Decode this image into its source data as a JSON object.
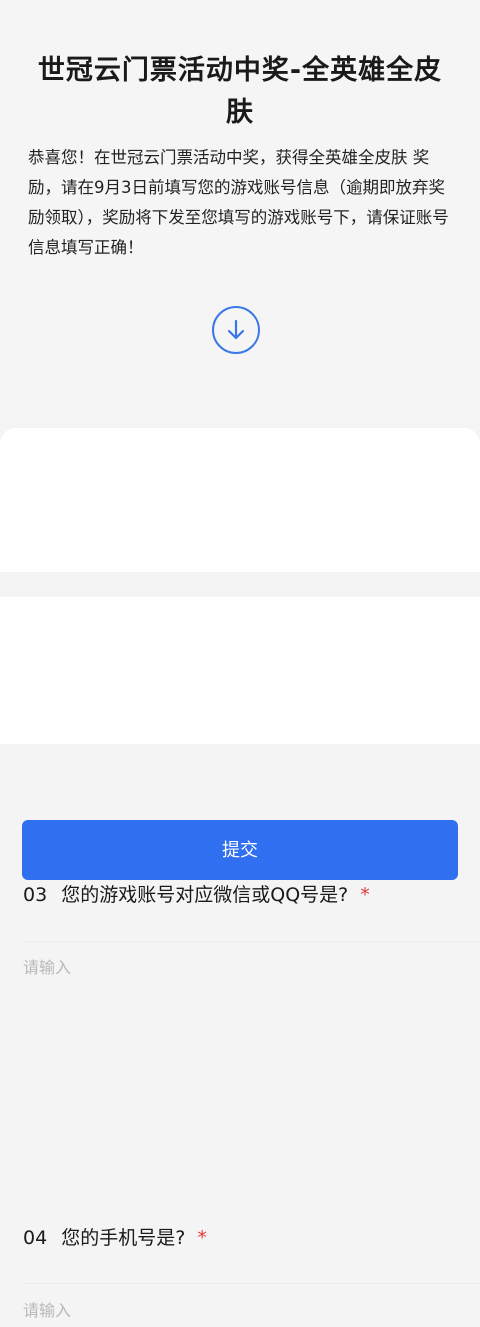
{
  "form": {
    "title": "世冠云门票活动中奖-全英雄全皮肤",
    "description": "恭喜您！在世冠云门票活动中奖，获得全英雄全皮肤 奖励，请在9月3日前填写您的游戏账号信息（逾期即放弃奖励领取），奖励将下发至您填写的游戏账号下，请保证账号信息填写正确！",
    "scroll_icon": "arrow-down-circle-icon",
    "accent_color": "#2f6ff0"
  },
  "questions": [
    {
      "number": "03",
      "label": "您的游戏账号对应微信或QQ号是?",
      "required_mark": "*",
      "placeholder": "请输入",
      "value": ""
    },
    {
      "number": "04",
      "label": "您的手机号是?",
      "required_mark": "*",
      "placeholder": "请输入",
      "value": ""
    }
  ],
  "submit": {
    "label": "提交"
  }
}
